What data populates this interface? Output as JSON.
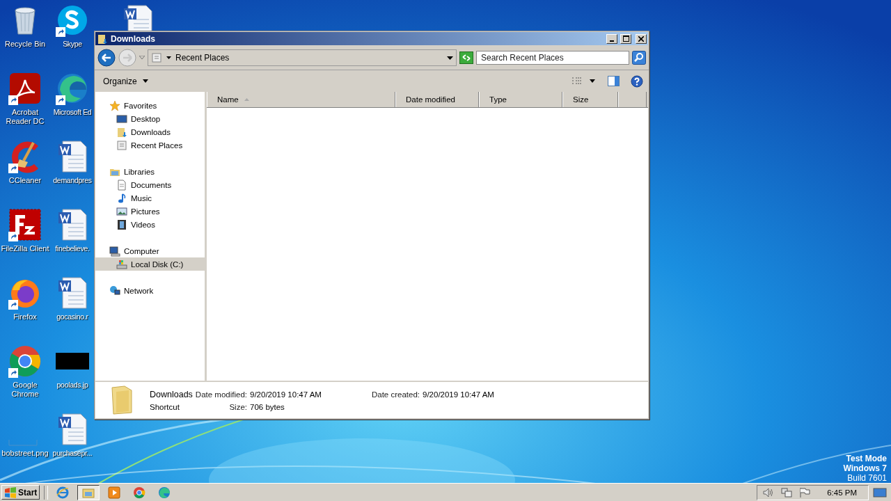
{
  "desktop_icons": [
    {
      "label": "Recycle Bin",
      "kind": "recycle",
      "shortcut": false
    },
    {
      "label": "Acrobat Reader DC",
      "kind": "acrobat",
      "shortcut": true
    },
    {
      "label": "CCleaner",
      "kind": "ccleaner",
      "shortcut": true
    },
    {
      "label": "FileZilla Client",
      "kind": "filezilla",
      "shortcut": true
    },
    {
      "label": "Firefox",
      "kind": "firefox",
      "shortcut": true
    },
    {
      "label": "Google Chrome",
      "kind": "chrome",
      "shortcut": true
    },
    {
      "label": "bobstreet.png",
      "kind": "blank-image",
      "shortcut": false
    },
    {
      "label": "Skype",
      "kind": "skype",
      "shortcut": true
    },
    {
      "label": "Microsoft Ed",
      "kind": "edge",
      "shortcut": true
    },
    {
      "label": "demandpres",
      "kind": "word",
      "shortcut": false
    },
    {
      "label": "finebelieve.",
      "kind": "word",
      "shortcut": false
    },
    {
      "label": "gocasino.r",
      "kind": "word",
      "shortcut": false
    },
    {
      "label": "poolads.jp",
      "kind": "dark-image",
      "shortcut": false
    },
    {
      "label": "purchasepr...",
      "kind": "word",
      "shortcut": false
    },
    {
      "kind": "word",
      "shortcut": false
    }
  ],
  "window": {
    "title": "Downloads",
    "address": "Recent Places",
    "search": {
      "placeholder": "Search Recent Places"
    },
    "toolbar": {
      "organize": "Organize"
    },
    "nav_tree": [
      {
        "label": "Favorites",
        "selected": false,
        "children": [
          {
            "label": "Desktop",
            "selected": false
          },
          {
            "label": "Downloads",
            "selected": false
          },
          {
            "label": "Recent Places",
            "selected": false
          }
        ]
      },
      {
        "label": "Libraries",
        "selected": false,
        "children": [
          {
            "label": "Documents",
            "selected": false
          },
          {
            "label": "Music",
            "selected": false
          },
          {
            "label": "Pictures",
            "selected": false
          },
          {
            "label": "Videos",
            "selected": false
          }
        ]
      },
      {
        "label": "Computer",
        "selected": false,
        "children": [
          {
            "label": "Local Disk (C:)",
            "selected": true
          }
        ]
      },
      {
        "label": "Network",
        "selected": false
      }
    ],
    "columns": [
      {
        "label": "Name",
        "sorted": true
      },
      {
        "label": "Date modified",
        "sorted": false
      },
      {
        "label": "Type",
        "sorted": false
      },
      {
        "label": "Size",
        "sorted": false
      }
    ],
    "details": {
      "name": "Downloads",
      "type": "Shortcut",
      "fields": [
        {
          "label": "Date modified:",
          "value": "9/20/2019 10:47 AM"
        },
        {
          "label": "Size:",
          "value": "706 bytes"
        },
        {
          "label": "Date created:",
          "value": "9/20/2019 10:47 AM"
        }
      ]
    }
  },
  "watermark_text": [
    "Test Mode",
    "Windows 7",
    "Build 7601"
  ],
  "taskbar": {
    "start": "Start",
    "items": [
      {
        "kind": "ie",
        "selected": false
      },
      {
        "kind": "explorer",
        "selected": true
      },
      {
        "kind": "media",
        "selected": false
      },
      {
        "kind": "chrome",
        "selected": false
      },
      {
        "kind": "edge",
        "selected": false
      }
    ],
    "clock": "6:45 PM"
  }
}
